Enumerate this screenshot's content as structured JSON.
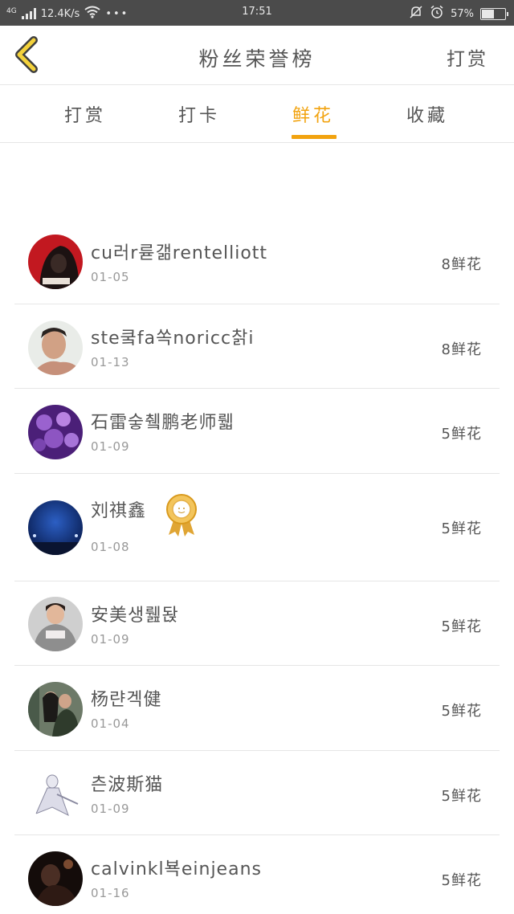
{
  "status_bar": {
    "network": "4G",
    "speed": "12.4K/s",
    "dots": "•••",
    "time": "17:51",
    "battery": "57%",
    "battery_level": 0.57
  },
  "header": {
    "title": "粉丝荣誉榜",
    "right_link": "打赏"
  },
  "tabs": [
    {
      "label": "打赏",
      "active": false
    },
    {
      "label": "打卡",
      "active": false
    },
    {
      "label": "鲜花",
      "active": true
    },
    {
      "label": "收藏",
      "active": false
    }
  ],
  "fans": [
    {
      "name": "cu러r륟갦rentelliott",
      "date": "01-05",
      "count": "8鲜花",
      "avatar": "red-hooded-figure",
      "avatar_color": "#b7151d"
    },
    {
      "name": "ste쿸fa쏙noricc찱i",
      "date": "01-13",
      "count": "8鲜花",
      "avatar": "boy-portrait",
      "avatar_color": "#c89a80"
    },
    {
      "name": "石雷숳췤鹏老师뤫",
      "date": "01-09",
      "count": "5鲜花",
      "avatar": "purple-flowers",
      "avatar_color": "#6b2fa0"
    },
    {
      "name": "刘祺鑫",
      "date": "01-08",
      "count": "5鲜花",
      "avatar": "night-sky",
      "avatar_color": "#123a8a",
      "medal": "gold-medal-icon"
    },
    {
      "name": "安美생뤮돥",
      "date": "01-09",
      "count": "5鲜花",
      "avatar": "child-photo",
      "avatar_color": "#9a9a9a"
    },
    {
      "name": "杨랸겍健",
      "date": "01-04",
      "count": "5鲜花",
      "avatar": "couple-photo",
      "avatar_color": "#3d4a3a"
    },
    {
      "name": "츤波斯猫",
      "date": "01-09",
      "count": "5鲜花",
      "avatar": "anime-figure",
      "avatar_color": "#dcdce8"
    },
    {
      "name": "calvinkl뵥einjeans",
      "date": "01-16",
      "count": "5鲜花",
      "avatar": "dark-concert",
      "avatar_color": "#2a1a16"
    }
  ]
}
